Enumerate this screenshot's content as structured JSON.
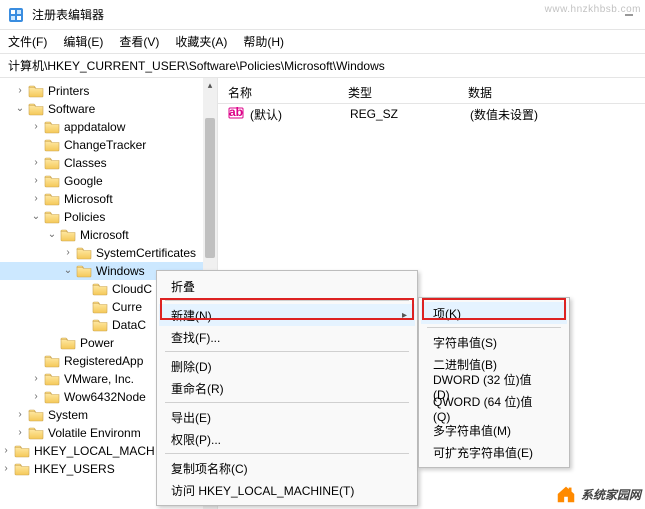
{
  "window": {
    "title": "注册表编辑器"
  },
  "menu": {
    "file": "文件(F)",
    "edit": "编辑(E)",
    "view": "查看(V)",
    "fav": "收藏夹(A)",
    "help": "帮助(H)"
  },
  "address": "计算机\\HKEY_CURRENT_USER\\Software\\Policies\\Microsoft\\Windows",
  "tree": {
    "printers": "Printers",
    "software": "Software",
    "appdatalow": "appdatalow",
    "changetracker": "ChangeTracker",
    "classes": "Classes",
    "google": "Google",
    "microsoft": "Microsoft",
    "policies": "Policies",
    "policies_microsoft": "Microsoft",
    "systemcertificates": "SystemCertificates",
    "windows": "Windows",
    "cloudc": "CloudC",
    "curre": "Curre",
    "datac": "DataC",
    "power": "Power",
    "registeredapp": "RegisteredApp",
    "vmware": "VMware, Inc.",
    "wow6432node": "Wow6432Node",
    "system": "System",
    "volatileenv": "Volatile Environm",
    "hklm": "HKEY_LOCAL_MACH",
    "hku": "HKEY_USERS"
  },
  "list": {
    "header": {
      "name": "名称",
      "type": "类型",
      "data": "数据"
    },
    "row0": {
      "name": "(默认)",
      "type": "REG_SZ",
      "data": "(数值未设置)"
    }
  },
  "cm1": {
    "collapse": "折叠",
    "new": "新建(N)",
    "find": "查找(F)...",
    "delete": "删除(D)",
    "rename": "重命名(R)",
    "export": "导出(E)",
    "perm": "权限(P)...",
    "copykey": "复制项名称(C)",
    "gohklm": "访问 HKEY_LOCAL_MACHINE(T)"
  },
  "cm2": {
    "key": "项(K)",
    "string": "字符串值(S)",
    "binary": "二进制值(B)",
    "dword": "DWORD (32 位)值(D)",
    "qword": "QWORD (64 位)值(Q)",
    "multistr": "多字符串值(M)",
    "expstr": "可扩充字符串值(E)"
  },
  "watermark": {
    "text": "系统家园网",
    "url": "www.hnzkhbsb.com"
  }
}
